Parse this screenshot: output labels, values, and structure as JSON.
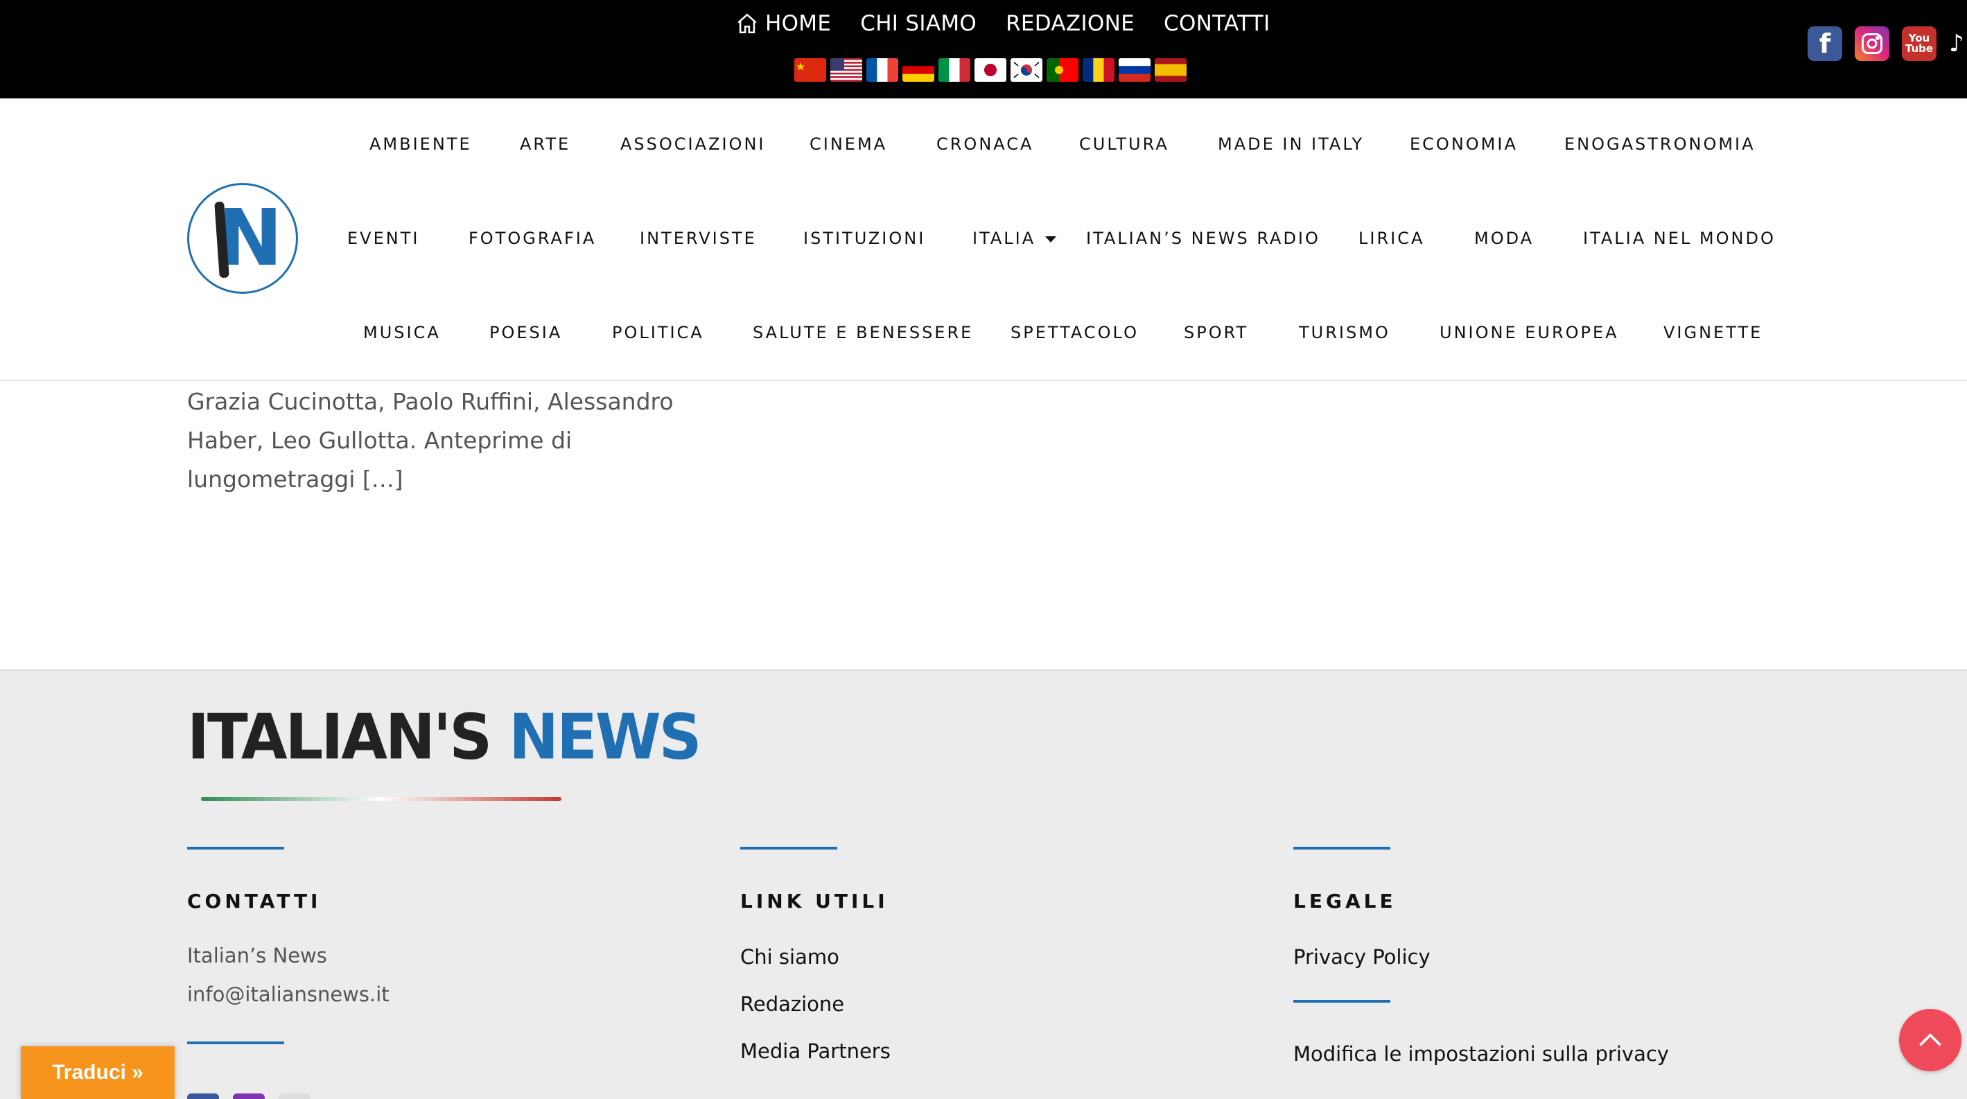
{
  "topnav": {
    "home": "HOME",
    "chi_siamo": "CHI SIAMO",
    "redazione": "REDAZIONE",
    "contatti": "CONTATTI"
  },
  "flags": [
    "flag-china-icon",
    "flag-usa-icon",
    "flag-france-icon",
    "flag-germany-icon",
    "flag-italy-icon",
    "flag-japan-icon",
    "flag-korea-icon",
    "flag-portugal-icon",
    "flag-romania-icon",
    "flag-russia-icon",
    "flag-spain-icon"
  ],
  "socials": [
    "facebook-icon",
    "instagram-icon",
    "youtube-icon",
    "tiktok-icon"
  ],
  "youtube_label": [
    "You",
    "Tube"
  ],
  "facebook_glyph": "f",
  "logo_letter": "N",
  "article": {
    "lines": [
      "Grazia Cucinotta, Paolo Ruffini, Alessandro",
      "Haber, Leo Gullotta. Anteprime di",
      "lungometraggi […]"
    ]
  },
  "menu": {
    "row1": [
      "AMBIENTE",
      "ARTE",
      "ASSOCIAZIONI",
      "CINEMA",
      "CRONACA",
      "CULTURA",
      "MADE IN ITALY",
      "ECONOMIA",
      "ENOGASTRONOMIA"
    ],
    "row2": [
      "EVENTI",
      "FOTOGRAFIA",
      "INTERVISTE",
      "ISTITUZIONI",
      "ITALIA",
      "ITALIAN’S NEWS RADIO",
      "LIRICA",
      "MODA",
      "ITALIA NEL MONDO"
    ],
    "row3": [
      "MUSICA",
      "POESIA",
      "POLITICA",
      "SALUTE E BENESSERE",
      "SPETTACOLO",
      "SPORT",
      "TURISMO",
      "UNIONE EUROPEA",
      "VIGNETTE"
    ]
  },
  "footer": {
    "logo_left": "ITALIAN'S",
    "logo_right": "NEWS",
    "contatti": {
      "title": "CONTATTI",
      "name": "Italian’s News",
      "email": "info@italiansnews.it"
    },
    "link_utili": {
      "title": "LINK UTILI",
      "links": [
        "Chi siamo",
        "Redazione",
        "Media Partners"
      ]
    },
    "legale": {
      "title": "LEGALE",
      "privacy": "Privacy Policy",
      "privacy_settings": "Modifica le impostazioni sulla privacy"
    }
  },
  "traduci": "Traduci »",
  "colors": {
    "accent_blue": "#1f6fb2",
    "top_bar": "#000000",
    "footer_bg": "#ececec",
    "traduci_bg": "#f7941d",
    "to_top_bg": "#ef4a5a"
  }
}
